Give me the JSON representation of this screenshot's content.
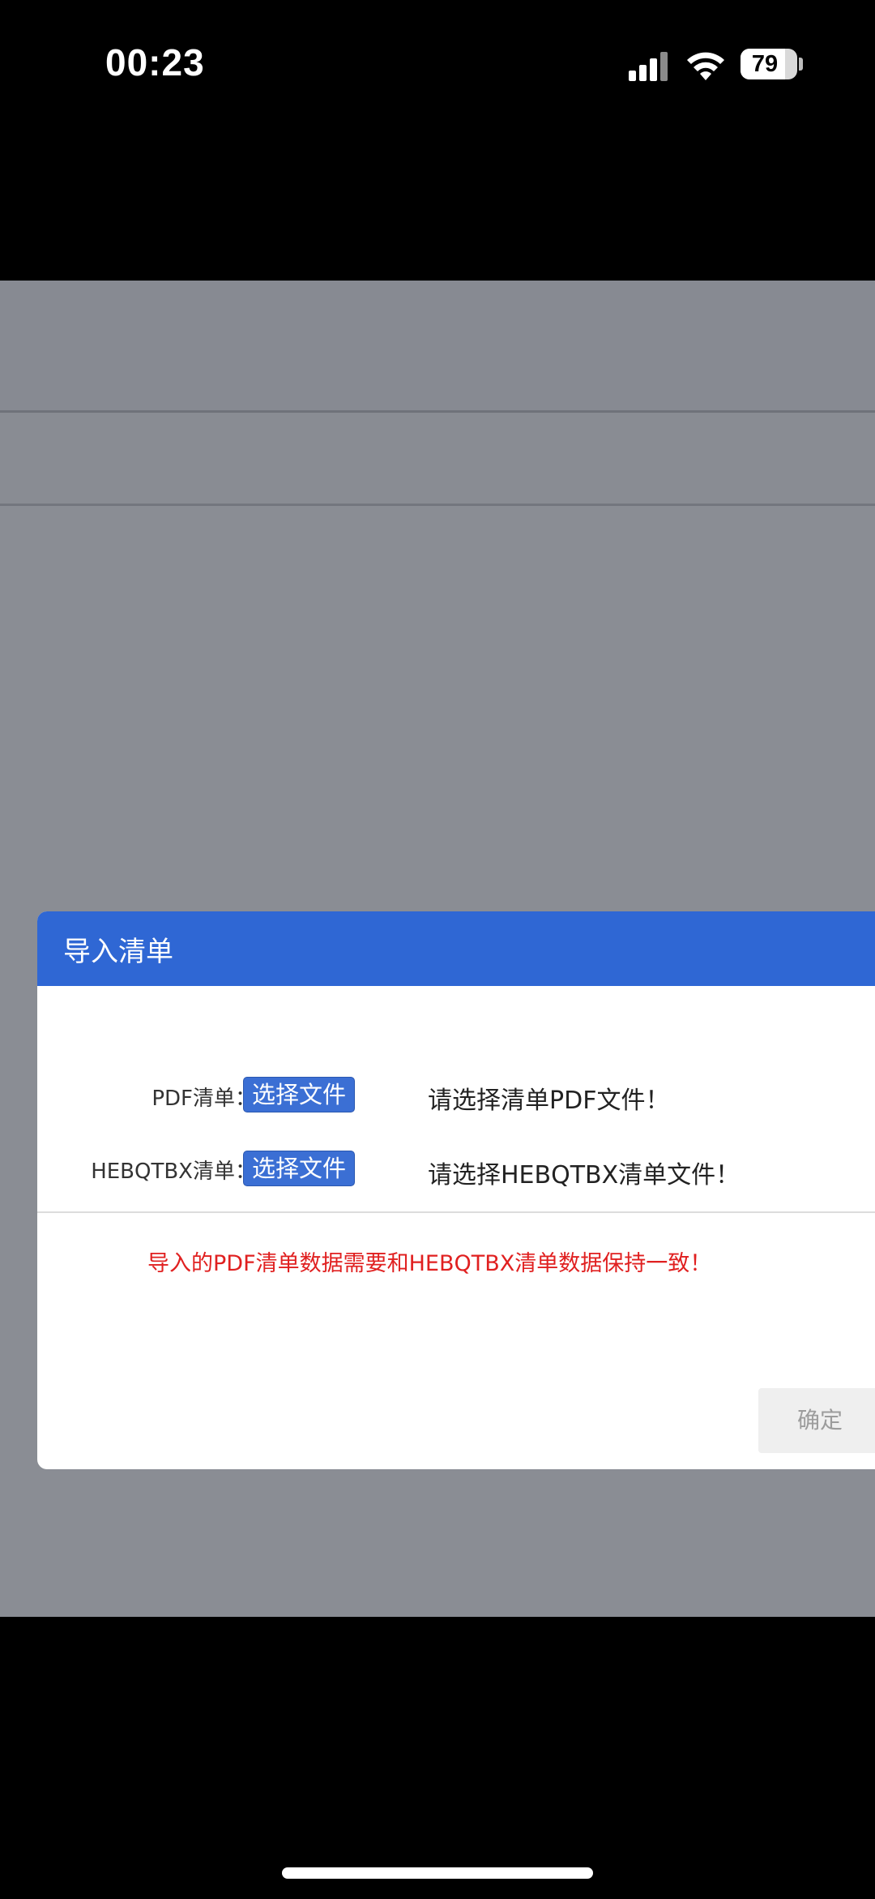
{
  "status_bar": {
    "time": "00:23",
    "battery_level": "79",
    "icons": [
      "signal-icon",
      "wifi-icon",
      "battery-icon"
    ]
  },
  "dialog": {
    "title": "导入清单",
    "pdf_row": {
      "label": "PDF清单：",
      "button": "选择文件",
      "hint": "请选择清单PDF文件！"
    },
    "hebqtbx_row": {
      "label": "HEBQTBX清单：",
      "button": "选择文件",
      "hint": "请选择HEBQTBX清单文件！"
    },
    "warning": "导入的PDF清单数据需要和HEBQTBX清单数据保持一致！",
    "confirm_label": "确定"
  },
  "colors": {
    "dialog_header": "#2f67d4",
    "file_button": "#3b6fd4",
    "warning_text": "#e02020",
    "overlay": "#8a8d94"
  }
}
